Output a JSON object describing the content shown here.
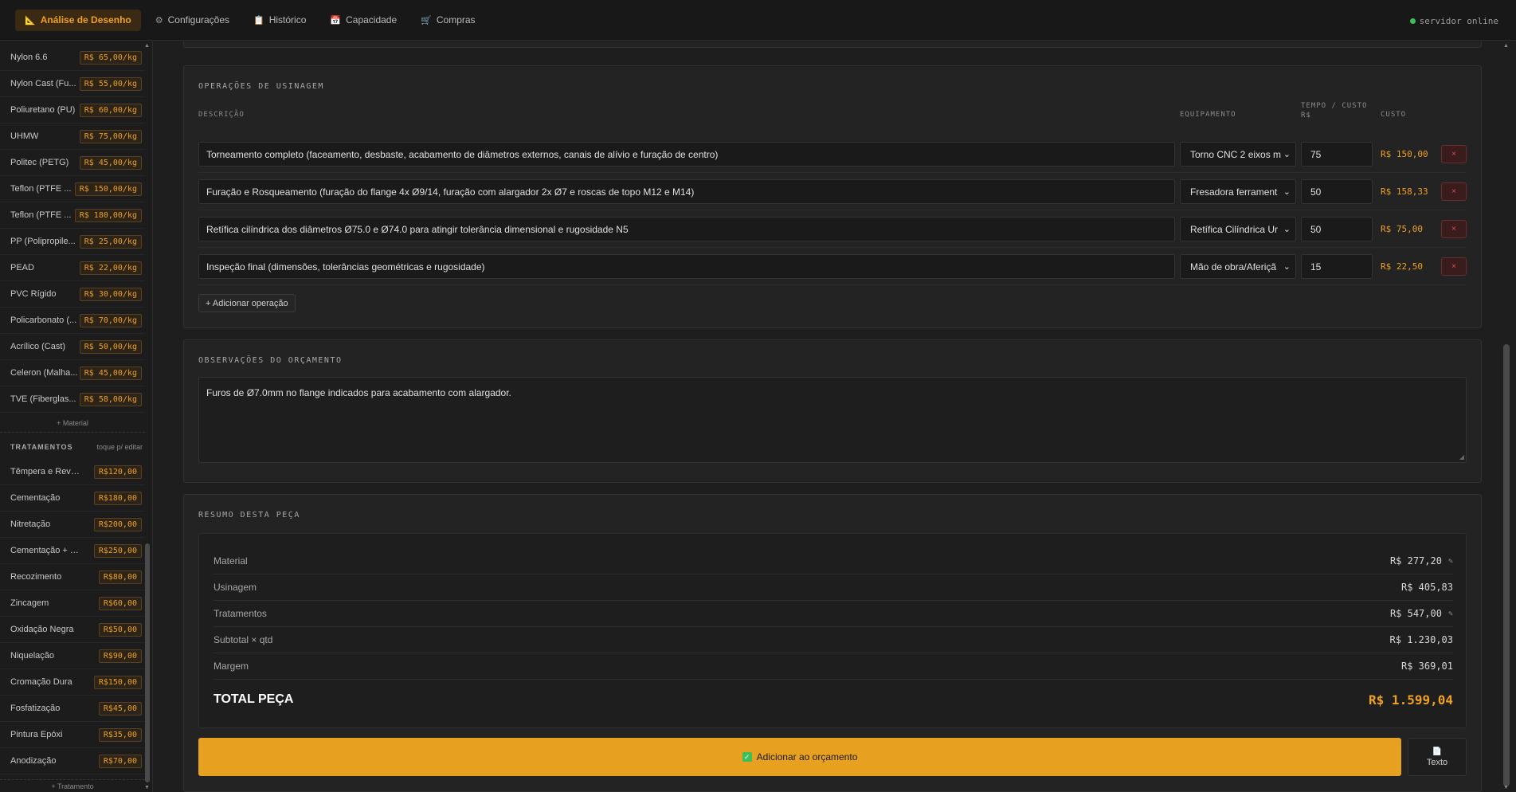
{
  "topbar": {
    "tabs": [
      {
        "label": "Análise de Desenho",
        "icon": "📐"
      },
      {
        "label": "Configurações",
        "icon": "⚙"
      },
      {
        "label": "Histórico",
        "icon": "📋"
      },
      {
        "label": "Capacidade",
        "icon": "📅"
      },
      {
        "label": "Compras",
        "icon": "🛒"
      }
    ],
    "status": "servidor online"
  },
  "sidebar": {
    "materials": [
      {
        "name": "Nylon 6.6",
        "price": "R$ 65,00/kg"
      },
      {
        "name": "Nylon Cast (Fu...",
        "price": "R$ 55,00/kg"
      },
      {
        "name": "Poliuretano (PU)",
        "price": "R$ 60,00/kg"
      },
      {
        "name": "UHMW",
        "price": "R$ 75,00/kg"
      },
      {
        "name": "Politec (PETG)",
        "price": "R$ 45,00/kg"
      },
      {
        "name": "Teflon (PTFE ...",
        "price": "R$ 150,00/kg"
      },
      {
        "name": "Teflon (PTFE ...",
        "price": "R$ 180,00/kg"
      },
      {
        "name": "PP (Polipropile...",
        "price": "R$ 25,00/kg"
      },
      {
        "name": "PEAD",
        "price": "R$ 22,00/kg"
      },
      {
        "name": "PVC Rígido",
        "price": "R$ 30,00/kg"
      },
      {
        "name": "Policarbonato (...",
        "price": "R$ 70,00/kg"
      },
      {
        "name": "Acrílico (Cast)",
        "price": "R$ 50,00/kg"
      },
      {
        "name": "Celeron (Malha...",
        "price": "R$ 45,00/kg"
      },
      {
        "name": "TVE (Fiberglas...",
        "price": "R$ 58,00/kg"
      }
    ],
    "add_material": "+ Material",
    "treatments_title": "TRATAMENTOS",
    "treatments_hint": "toque p/ editar",
    "treatments": [
      {
        "name": "Têmpera e Reveni...",
        "price": "R$120,00"
      },
      {
        "name": "Cementação",
        "price": "R$180,00"
      },
      {
        "name": "Nitretação",
        "price": "R$200,00"
      },
      {
        "name": "Cementação + Tê...",
        "price": "R$250,00"
      },
      {
        "name": "Recozimento",
        "price": "R$80,00"
      },
      {
        "name": "Zincagem",
        "price": "R$60,00"
      },
      {
        "name": "Oxidação Negra",
        "price": "R$50,00"
      },
      {
        "name": "Niquelação",
        "price": "R$90,00"
      },
      {
        "name": "Cromação Dura",
        "price": "R$150,00"
      },
      {
        "name": "Fosfatização",
        "price": "R$45,00"
      },
      {
        "name": "Pintura Epóxi",
        "price": "R$35,00"
      },
      {
        "name": "Anodização",
        "price": "R$70,00"
      }
    ],
    "add_treatment": "+ Tratamento"
  },
  "operations": {
    "title": "OPERAÇÕES DE USINAGEM",
    "col_desc": "DESCRIÇÃO",
    "col_equip": "EQUIPAMENTO",
    "col_time_1": "TEMPO / CUSTO",
    "col_time_2": "R$",
    "col_cost": "CUSTO",
    "rows": [
      {
        "desc": "Torneamento completo (faceamento, desbaste, acabamento de diâmetros externos, canais de alívio e furação de centro)",
        "equip": "Torno CNC 2 eixos m",
        "time": "75",
        "cost": "R$ 150,00"
      },
      {
        "desc": "Furação e Rosqueamento (furação do flange 4x Ø9/14, furação com alargador 2x Ø7 e roscas de topo M12 e M14)",
        "equip": "Fresadora ferrament",
        "time": "50",
        "cost": "R$ 158,33"
      },
      {
        "desc": "Retífica cilíndrica dos diâmetros Ø75.0 e Ø74.0 para atingir tolerância dimensional e rugosidade N5",
        "equip": "Retífica Cilíndrica Ur",
        "time": "50",
        "cost": "R$ 75,00"
      },
      {
        "desc": "Inspeção final (dimensões, tolerâncias geométricas e rugosidade)",
        "equip": "Mão de obra/Aferiçã",
        "time": "15",
        "cost": "R$ 22,50"
      }
    ],
    "delete_label": "×",
    "add_label": "+ Adicionar operação"
  },
  "observations": {
    "title": "OBSERVAÇÕES DO ORÇAMENTO",
    "text": "Furos de Ø7.0mm no flange indicados para acabamento com alargador."
  },
  "summary": {
    "title": "RESUMO DESTA PEÇA",
    "rows": [
      {
        "label": "Material",
        "value": "R$ 277,20"
      },
      {
        "label": "Usinagem",
        "value": "R$ 405,83"
      },
      {
        "label": "Tratamentos",
        "value": "R$ 547,00"
      },
      {
        "label": "Subtotal × qtd",
        "value": "R$ 1.230,03"
      },
      {
        "label": "Margem",
        "value": "R$ 369,01"
      }
    ],
    "total_label": "TOTAL PEÇA",
    "total_value": "R$ 1.599,04",
    "add_button": "Adicionar ao orçamento",
    "text_button": "Texto"
  }
}
